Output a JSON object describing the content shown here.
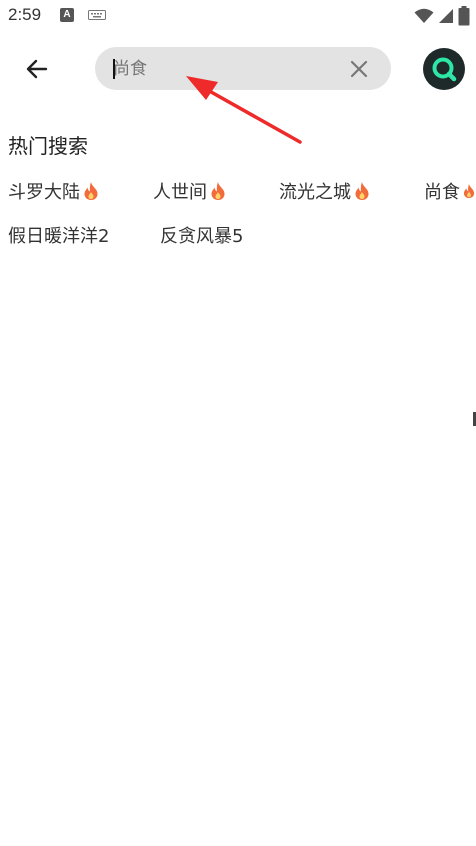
{
  "status_bar": {
    "time": "2:59",
    "notification_icon_letter": "A",
    "icons": [
      "a-notification-icon",
      "keyboard-icon",
      "wifi-icon",
      "signal-icon",
      "battery-icon"
    ]
  },
  "search": {
    "value": "",
    "placeholder": "尚食",
    "back_icon": "arrow-left-icon",
    "clear_icon": "close-icon",
    "submit_icon": "search-icon"
  },
  "hot_search": {
    "title": "热门搜索",
    "tags": [
      {
        "label": "斗罗大陆",
        "hot": true
      },
      {
        "label": "人世间",
        "hot": true
      },
      {
        "label": "流光之城",
        "hot": true
      },
      {
        "label": "尚食",
        "hot": true
      },
      {
        "label": "假日暖洋洋2",
        "hot": false
      },
      {
        "label": "反贪风暴5",
        "hot": false
      }
    ]
  },
  "colors": {
    "accent": "#2ee6a6",
    "submit_bg": "#1e2a2a",
    "search_bg": "#e3e3e3",
    "annotation": "#ee2a2a",
    "fire": "#f26b3a"
  }
}
